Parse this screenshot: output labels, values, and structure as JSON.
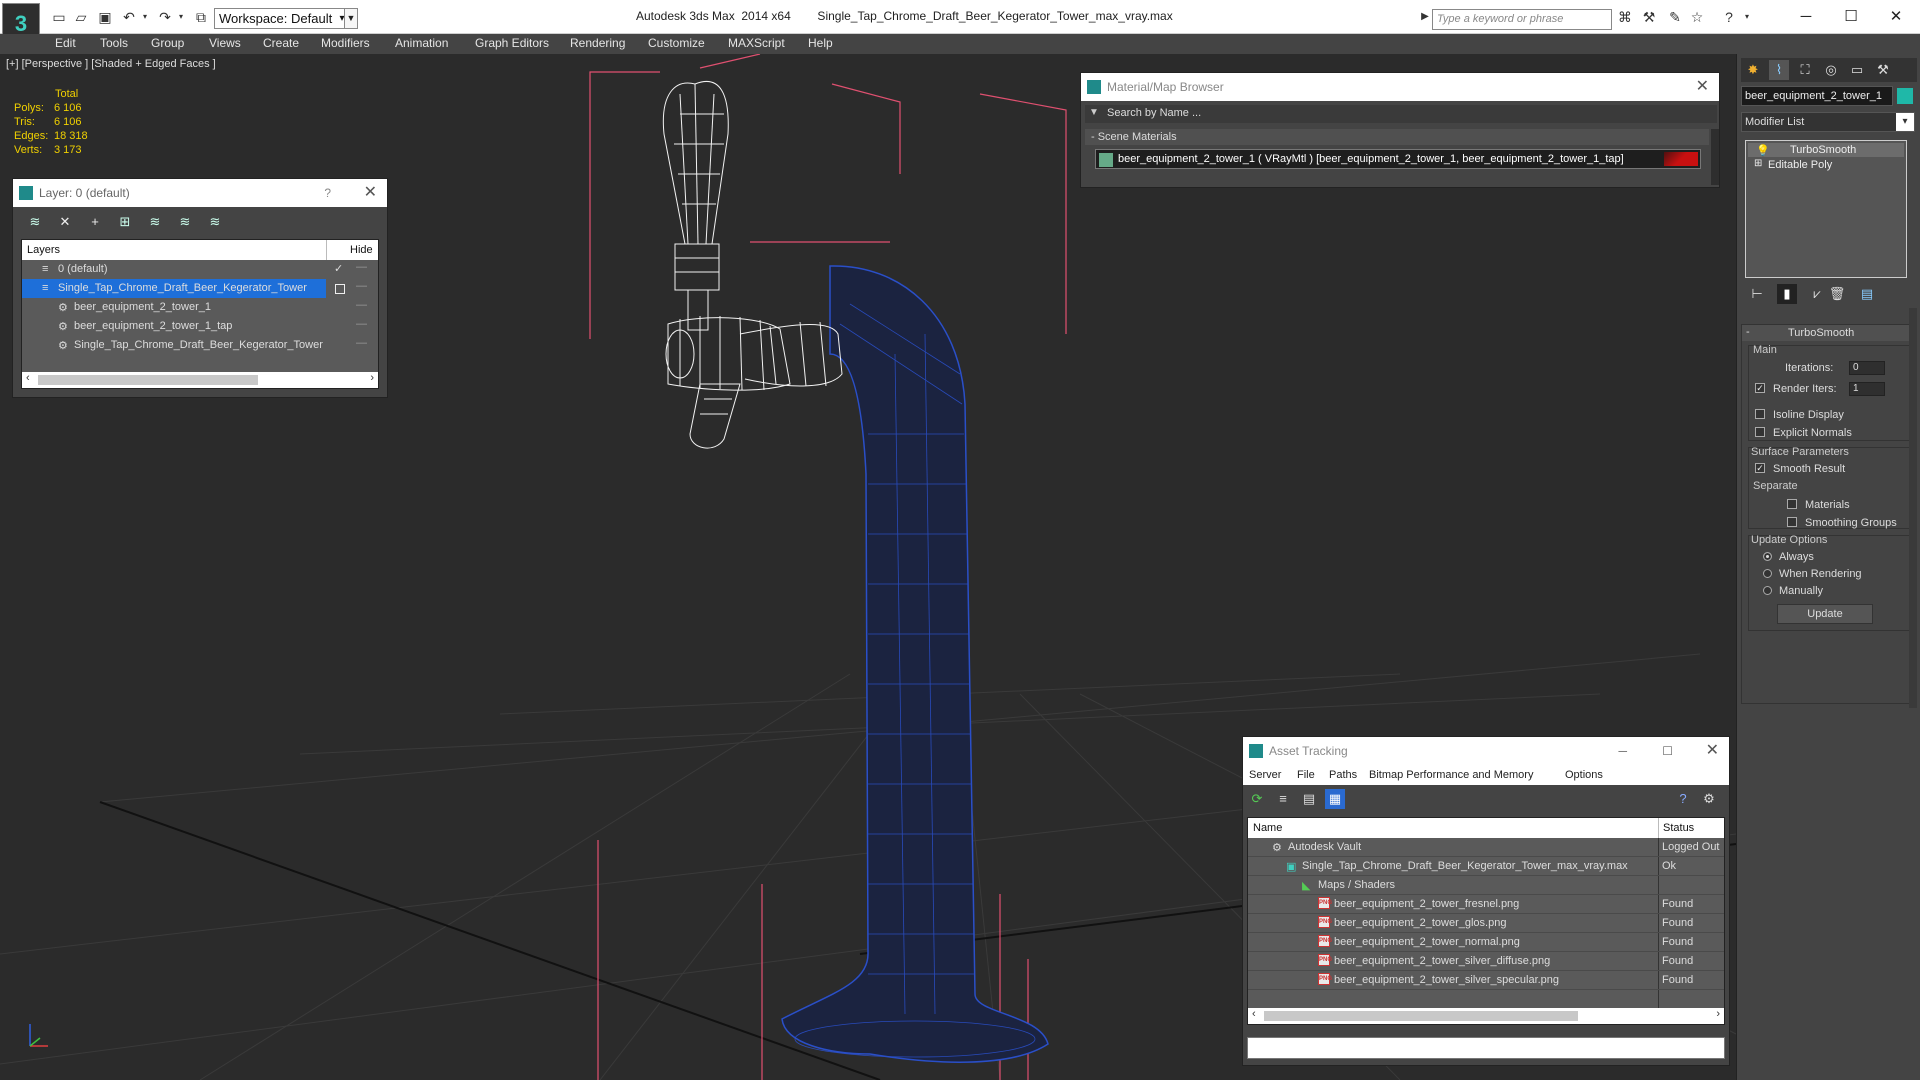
{
  "titlebar": {
    "app_logo": "3",
    "workspace_label": "Workspace: Default",
    "app_title": "Autodesk 3ds Max  2014 x64        Single_Tap_Chrome_Draft_Beer_Kegerator_Tower_max_vray.max",
    "search_placeholder": "Type a keyword or phrase"
  },
  "menu": [
    "Edit",
    "Tools",
    "Group",
    "Views",
    "Create",
    "Modifiers",
    "Animation",
    "Graph Editors",
    "Rendering",
    "Customize",
    "MAXScript",
    "Help"
  ],
  "viewport": {
    "label": "[+] [Perspective ] [Shaded + Edged Faces ]",
    "stats": {
      "total_label": "Total",
      "rows": [
        {
          "label": "Polys:",
          "value": "6 106"
        },
        {
          "label": "Tris:",
          "value": "6 106"
        },
        {
          "label": "Edges:",
          "value": "18 318"
        },
        {
          "label": "Verts:",
          "value": "3 173"
        }
      ]
    }
  },
  "layer_dialog": {
    "title": "Layer: 0 (default)",
    "help": "?",
    "col_layers": "Layers",
    "col_hide": "Hide",
    "rows": [
      {
        "name": "0 (default)",
        "indent": 0,
        "selected": false
      },
      {
        "name": "Single_Tap_Chrome_Draft_Beer_Kegerator_Tower",
        "indent": 0,
        "selected": true
      },
      {
        "name": "beer_equipment_2_tower_1",
        "indent": 1,
        "selected": false
      },
      {
        "name": "beer_equipment_2_tower_1_tap",
        "indent": 1,
        "selected": false
      },
      {
        "name": "Single_Tap_Chrome_Draft_Beer_Kegerator_Tower",
        "indent": 1,
        "selected": false
      }
    ]
  },
  "material_browser": {
    "title": "Material/Map Browser",
    "search_placeholder": "Search by Name ...",
    "section": "- Scene Materials",
    "material": "beer_equipment_2_tower_1  ( VRayMtl ) [beer_equipment_2_tower_1, beer_equipment_2_tower_1_tap]"
  },
  "asset_tracking": {
    "title": "Asset Tracking",
    "menu": [
      "Server",
      "File",
      "Paths",
      "Bitmap Performance and Memory",
      "Options"
    ],
    "col_name": "Name",
    "col_status": "Status",
    "rows": [
      {
        "name": "Autodesk Vault",
        "status": "Logged Out",
        "indent": 0,
        "icon": "vault"
      },
      {
        "name": "Single_Tap_Chrome_Draft_Beer_Kegerator_Tower_max_vray.max",
        "status": "Ok",
        "indent": 1,
        "icon": "max"
      },
      {
        "name": "Maps / Shaders",
        "status": "",
        "indent": 2,
        "icon": "folder"
      },
      {
        "name": "beer_equipment_2_tower_fresnel.png",
        "status": "Found",
        "indent": 3,
        "icon": "png"
      },
      {
        "name": "beer_equipment_2_tower_glos.png",
        "status": "Found",
        "indent": 3,
        "icon": "png"
      },
      {
        "name": "beer_equipment_2_tower_normal.png",
        "status": "Found",
        "indent": 3,
        "icon": "png"
      },
      {
        "name": "beer_equipment_2_tower_silver_diffuse.png",
        "status": "Found",
        "indent": 3,
        "icon": "png"
      },
      {
        "name": "beer_equipment_2_tower_silver_specular.png",
        "status": "Found",
        "indent": 3,
        "icon": "png"
      }
    ]
  },
  "command_panel": {
    "object_name": "beer_equipment_2_tower_1",
    "object_color": "#1fb8a8",
    "modifier_list": "Modifier List",
    "stack": [
      "TurboSmooth",
      "Editable Poly"
    ],
    "rollout_title": "TurboSmooth",
    "main_label": "Main",
    "iterations_label": "Iterations:",
    "iterations_value": "0",
    "render_iters_label": "Render Iters:",
    "render_iters_value": "1",
    "isoline_label": "Isoline Display",
    "explicit_label": "Explicit Normals",
    "surface_label": "Surface Parameters",
    "smooth_label": "Smooth Result",
    "separate_label": "Separate",
    "materials_label": "Materials",
    "smoothing_label": "Smoothing Groups",
    "update_opts_label": "Update Options",
    "always_label": "Always",
    "when_rendering_label": "When Rendering",
    "manually_label": "Manually",
    "update_button": "Update"
  },
  "colors": {
    "selection_blue": "#1e6fd9",
    "mesh_blue": "#2a4fc8",
    "bbox_pink": "#e05070",
    "teal": "#1fb8a8"
  }
}
